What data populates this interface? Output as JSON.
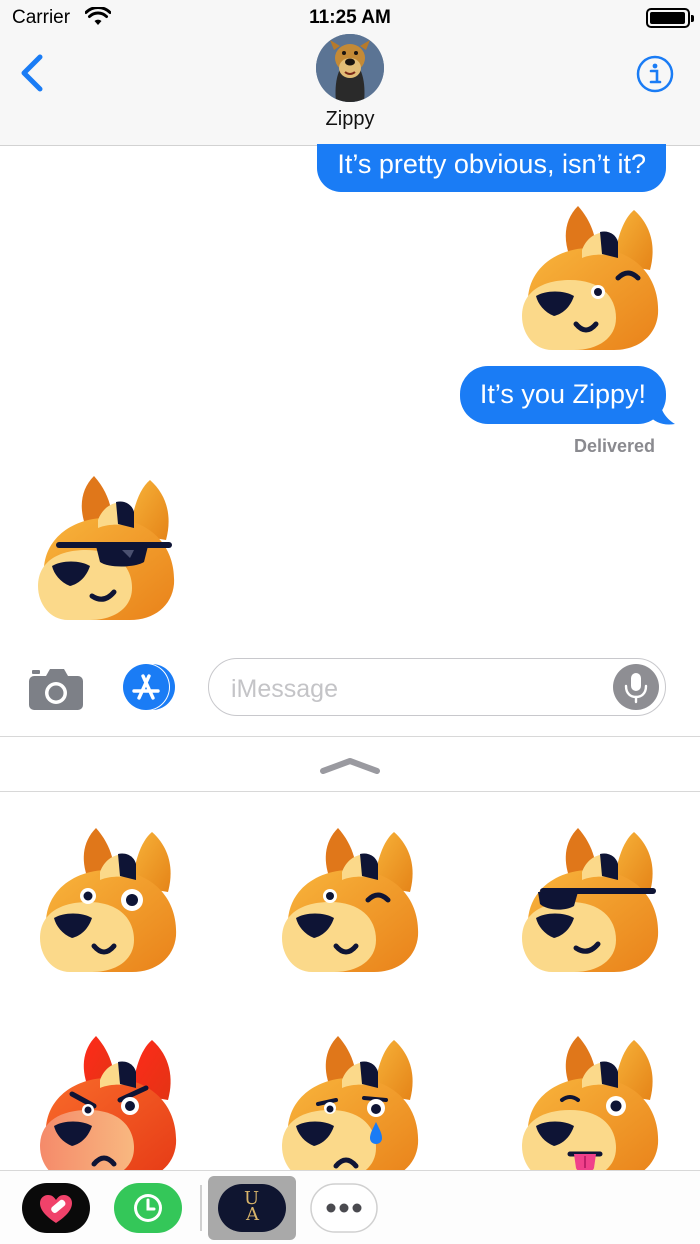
{
  "status_bar": {
    "carrier": "Carrier",
    "time": "11:25 AM",
    "wifi_icon": "wifi-icon",
    "battery_icon": "battery-icon"
  },
  "header": {
    "back_icon": "chevron-left-icon",
    "contact_name": "Zippy",
    "info_icon": "info-icon"
  },
  "conversation": {
    "messages": [
      {
        "type": "text",
        "sender": "me",
        "text": "It’s pretty obvious, isn’t it?"
      },
      {
        "type": "sticker",
        "sender": "me",
        "sticker": "winking-dog-sticker"
      },
      {
        "type": "text",
        "sender": "me",
        "text": "It’s you Zippy!"
      },
      {
        "type": "sticker",
        "sender": "them",
        "sticker": "sunglasses-dog-sticker"
      }
    ],
    "status": "Delivered"
  },
  "compose": {
    "camera_icon": "camera-icon",
    "appstore_icon": "app-store-icon",
    "placeholder": "iMessage",
    "mic_icon": "microphone-icon"
  },
  "drawer": {
    "handle_icon": "chevron-up-icon",
    "stickers": [
      "happy-dog",
      "winking-dog",
      "sunglasses-dog",
      "angry-dog",
      "crying-dog",
      "tongue-out-dog"
    ]
  },
  "app_tray": {
    "apps": [
      "heart-bandage-app",
      "clock-app",
      "ua-sticker-app",
      "more-apps"
    ],
    "selected_app_monogram_top": "U",
    "selected_app_monogram_bottom": "A"
  },
  "colors": {
    "bubble_blue": "#1a7cf5",
    "tint_blue": "#1a7cf5",
    "dog_orange": "#f0961e",
    "dog_muzzle": "#fbd98a",
    "dog_navy": "#0e1435",
    "angry_red": "#ee3f1e"
  }
}
